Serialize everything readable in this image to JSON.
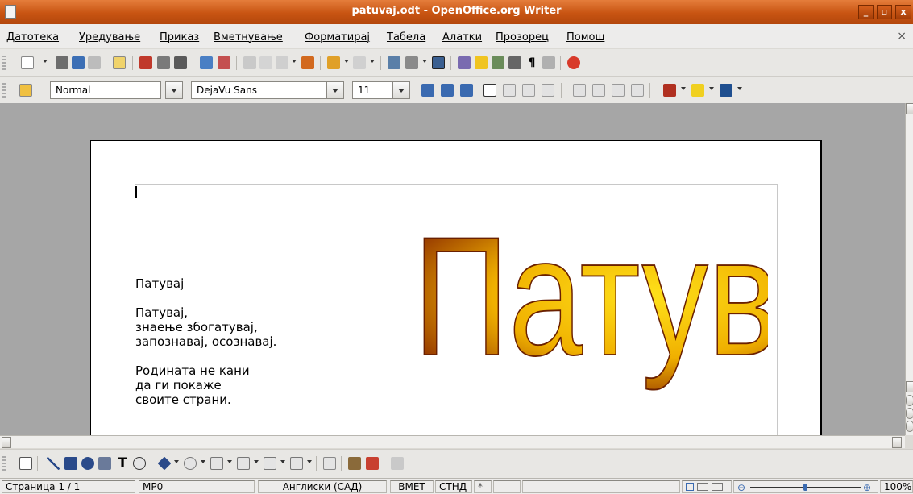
{
  "window": {
    "title": "patuvaj.odt - OpenOffice.org Writer",
    "minimize": "_",
    "maximize": "▫",
    "close": "x"
  },
  "menu": {
    "items": [
      "Датотека",
      "Уредување",
      "Приказ",
      "Вметнување",
      "Форматирај",
      "Табела",
      "Алатки",
      "Прозорец",
      "Помош"
    ],
    "doc_close": "×"
  },
  "formatting": {
    "style_value": "Normal",
    "font_value": "DejaVu Sans",
    "size_value": "11"
  },
  "document": {
    "poem_title": "Патувај",
    "stanza1": [
      "Патувај,",
      "знаење збогатувај,",
      "запознавај, осознавај."
    ],
    "stanza2": [
      "Родината не кани",
      "да ги покаже",
      "своите страни."
    ],
    "fontwork_text": "Патувај"
  },
  "status": {
    "page": "Страница 1 / 1",
    "style": "МР0",
    "language": "Англиски (САД)",
    "insert_mode": "ВМЕТ",
    "selection_mode": "СТНД",
    "modified": "*",
    "zoom": "100%"
  },
  "colors": {
    "title_bar": "#c85412",
    "workspace": "#a6a6a6",
    "fontwork_dark": "#8b2b00",
    "fontwork_light": "#ffe11a"
  }
}
